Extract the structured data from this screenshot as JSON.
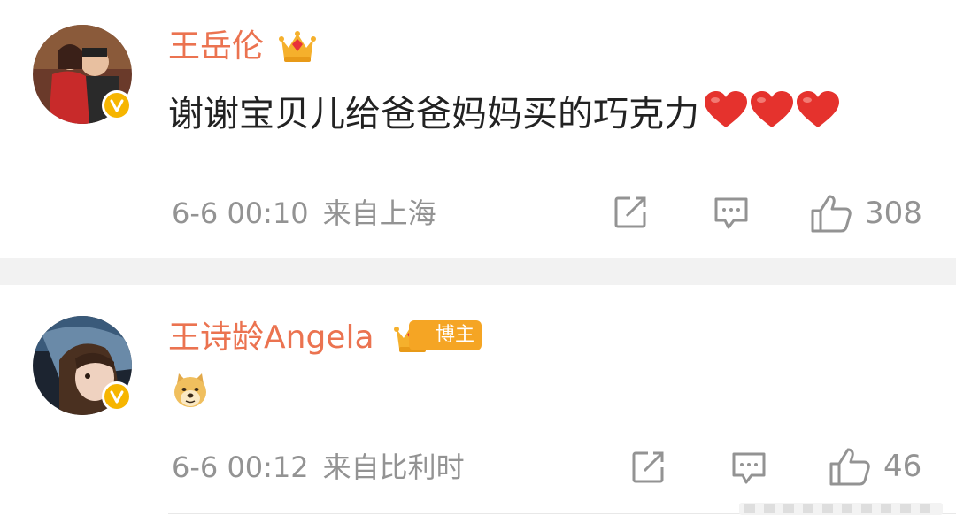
{
  "comments": [
    {
      "username": "王岳伦",
      "text": "谢谢宝贝儿给爸爸妈妈买的巧克力",
      "emoji": "❤️❤️❤️",
      "time": "6-6 00:10",
      "source": "来自上海",
      "likes": "308",
      "icons": [
        "crown-badge",
        "verified-v",
        "repost-icon",
        "comment-icon",
        "like-icon"
      ]
    },
    {
      "username": "王诗龄Angela",
      "badge": "博主",
      "time": "6-6 00:12",
      "source": "来自比利时",
      "likes": "46",
      "sticker": "doge-emoji",
      "icons": [
        "crown-badge",
        "verified-v",
        "repost-icon",
        "comment-icon",
        "like-icon"
      ]
    }
  ],
  "colors": {
    "username": "#eb7350",
    "meta": "#939393",
    "separator": "#f2f2f2",
    "verified": "#f6b500",
    "heart": "#e5322d"
  }
}
